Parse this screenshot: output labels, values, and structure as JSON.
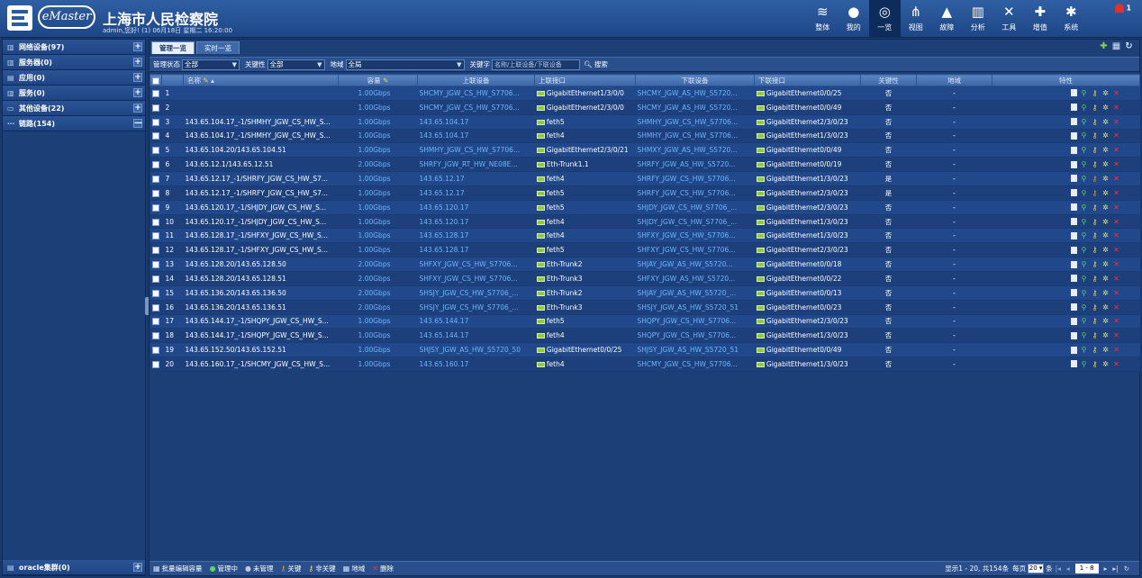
{
  "header": {
    "brand": "eMaster",
    "org_title": "上海市人民检察院",
    "user_info": "admin,您好! (1) 06月18日 星期二 16:20:00",
    "alarm_count": "1",
    "nav": [
      {
        "label": "整体",
        "icon": "layers-icon",
        "glyph": "≋",
        "active": false
      },
      {
        "label": "我的",
        "icon": "user-icon",
        "glyph": "●",
        "active": false
      },
      {
        "label": "一览",
        "icon": "globe-icon",
        "glyph": "◎",
        "active": true
      },
      {
        "label": "视图",
        "icon": "topology-icon",
        "glyph": "⋔",
        "active": false
      },
      {
        "label": "故障",
        "icon": "warning-icon",
        "glyph": "▲",
        "active": false
      },
      {
        "label": "分析",
        "icon": "chart-icon",
        "glyph": "▥",
        "active": false
      },
      {
        "label": "工具",
        "icon": "tools-icon",
        "glyph": "✕",
        "active": false
      },
      {
        "label": "增值",
        "icon": "plus-icon",
        "glyph": "✚",
        "active": false
      },
      {
        "label": "系统",
        "icon": "gear-icon",
        "glyph": "✱",
        "active": false
      }
    ]
  },
  "sidebar": {
    "items": [
      {
        "label": "网络设备(97)",
        "btn": "+"
      },
      {
        "label": "服务器(0)",
        "btn": "+"
      },
      {
        "label": "应用(0)",
        "btn": "+"
      },
      {
        "label": "服务(0)",
        "btn": "+"
      },
      {
        "label": "其他设备(22)",
        "btn": "+"
      },
      {
        "label": "链路(154)",
        "btn": "—"
      }
    ],
    "bottom": {
      "label": "oracle集群(0)",
      "btn": "+"
    }
  },
  "tabs": [
    {
      "label": "管理一览",
      "active": true
    },
    {
      "label": "实时一览",
      "active": false
    }
  ],
  "filters": {
    "mgmt_label": "管理状态",
    "mgmt_value": "全部",
    "key_label": "关键性",
    "key_value": "全部",
    "region_label": "地域",
    "region_value": "全局",
    "keyword_label": "关键字",
    "keyword_placeholder": "名称/上联设备/下联设备",
    "search_label": "搜索"
  },
  "columns": {
    "name": "名称",
    "capacity": "容量",
    "up_device": "上联设备",
    "up_port": "上联接口",
    "down_device": "下联设备",
    "down_port": "下联接口",
    "key": "关键性",
    "region": "地域",
    "props": "特性"
  },
  "rows": [
    {
      "n": "1",
      "name": "",
      "cap": "1.00Gbps",
      "up": "SHCMY_JGW_CS_HW_S7706...",
      "upp": "GigabitEthernet1/3/0/0",
      "down": "SHCMY_JGW_AS_HW_S5720...",
      "downp": "GigabitEthernet0/0/25",
      "key": "否",
      "region": "-"
    },
    {
      "n": "2",
      "name": "",
      "cap": "1.00Gbps",
      "up": "SHCMY_JGW_CS_HW_S7706...",
      "upp": "GigabitEthernet2/3/0/0",
      "down": "SHCMY_JGW_AS_HW_S5720...",
      "downp": "GigabitEthernet0/0/49",
      "key": "否",
      "region": "-"
    },
    {
      "n": "3",
      "name": "143.65.104.17_-1/SHMHY_JGW_CS_HW_S...",
      "cap": "1.00Gbps",
      "up": "143.65.104.17",
      "upp": "feth5",
      "down": "SHMHY_JGW_CS_HW_S7706...",
      "downp": "GigabitEthernet2/3/0/23",
      "key": "否",
      "region": "-"
    },
    {
      "n": "4",
      "name": "143.65.104.17_-1/SHMHY_JGW_CS_HW_S...",
      "cap": "1.00Gbps",
      "up": "143.65.104.17",
      "upp": "feth4",
      "down": "SHMHY_JGW_CS_HW_S7706...",
      "downp": "GigabitEthernet1/3/0/23",
      "key": "否",
      "region": "-"
    },
    {
      "n": "5",
      "name": "143.65.104.20/143.65.104.51",
      "cap": "1.00Gbps",
      "up": "SHMHY_JGW_CS_HW_S7706...",
      "upp": "GigabitEthernet2/3/0/21",
      "down": "SHMXY_JGW_AS_HW_S5720...",
      "downp": "GigabitEthernet0/0/49",
      "key": "否",
      "region": "-"
    },
    {
      "n": "6",
      "name": "143.65.12.1/143.65.12.51",
      "cap": "2.00Gbps",
      "up": "SHRFY_JGW_RT_HW_NE08E...",
      "upp": "Eth-Trunk1.1",
      "down": "SHRFY_JGW_AS_HW_S5720...",
      "downp": "GigabitEthernet0/0/19",
      "key": "否",
      "region": "-"
    },
    {
      "n": "7",
      "name": "143.65.12.17_-1/SHRFY_JGW_CS_HW_S7...",
      "cap": "1.00Gbps",
      "up": "143.65.12.17",
      "upp": "feth4",
      "down": "SHRFY_JGW_CS_HW_S7706...",
      "downp": "GigabitEthernet1/3/0/23",
      "key": "是",
      "region": "-"
    },
    {
      "n": "8",
      "name": "143.65.12.17_-1/SHRFY_JGW_CS_HW_S7...",
      "cap": "1.00Gbps",
      "up": "143.65.12.17",
      "upp": "feth5",
      "down": "SHRFY_JGW_CS_HW_S7706...",
      "downp": "GigabitEthernet2/3/0/23",
      "key": "是",
      "region": "-"
    },
    {
      "n": "9",
      "name": "143.65.120.17_-1/SHJDY_JGW_CS_HW_S...",
      "cap": "1.00Gbps",
      "up": "143.65.120.17",
      "upp": "feth5",
      "down": "SHJDY_JGW_CS_HW_S7706_...",
      "downp": "GigabitEthernet2/3/0/23",
      "key": "否",
      "region": "-"
    },
    {
      "n": "10",
      "name": "143.65.120.17_-1/SHJDY_JGW_CS_HW_S...",
      "cap": "1.00Gbps",
      "up": "143.65.120.17",
      "upp": "feth4",
      "down": "SHJDY_JGW_CS_HW_S7706_...",
      "downp": "GigabitEthernet1/3/0/23",
      "key": "否",
      "region": "-"
    },
    {
      "n": "11",
      "name": "143.65.128.17_-1/SHFXY_JGW_CS_HW_S...",
      "cap": "1.00Gbps",
      "up": "143.65.128.17",
      "upp": "feth4",
      "down": "SHFXY_JGW_CS_HW_S7706...",
      "downp": "GigabitEthernet1/3/0/23",
      "key": "否",
      "region": "-"
    },
    {
      "n": "12",
      "name": "143.65.128.17_-1/SHFXY_JGW_CS_HW_S...",
      "cap": "1.00Gbps",
      "up": "143.65.128.17",
      "upp": "feth5",
      "down": "SHFXY_JGW_CS_HW_S7706...",
      "downp": "GigabitEthernet2/3/0/23",
      "key": "否",
      "region": "-"
    },
    {
      "n": "13",
      "name": "143.65.128.20/143.65.128.50",
      "cap": "2.00Gbps",
      "up": "SHFXY_JGW_CS_HW_S7706...",
      "upp": "Eth-Trunk2",
      "down": "SHJAY_JGW_AS_HW_S5720...",
      "downp": "GigabitEthernet0/0/18",
      "key": "否",
      "region": "-"
    },
    {
      "n": "14",
      "name": "143.65.128.20/143.65.128.51",
      "cap": "2.00Gbps",
      "up": "SHFXY_JGW_CS_HW_S7706...",
      "upp": "Eth-Trunk3",
      "down": "SHFXY_JGW_AS_HW_S5720...",
      "downp": "GigabitEthernet0/0/22",
      "key": "否",
      "region": "-"
    },
    {
      "n": "15",
      "name": "143.65.136.20/143.65.136.50",
      "cap": "2.00Gbps",
      "up": "SHSJY_JGW_CS_HW_S7706_...",
      "upp": "Eth-Trunk2",
      "down": "SHJAY_JGW_AS_HW_S5720_...",
      "downp": "GigabitEthernet0/0/13",
      "key": "否",
      "region": "-"
    },
    {
      "n": "16",
      "name": "143.65.136.20/143.65.136.51",
      "cap": "2.00Gbps",
      "up": "SHSJY_JGW_CS_HW_S7706_...",
      "upp": "Eth-Trunk3",
      "down": "SHSJY_JGW_AS_HW_S5720_51",
      "downp": "GigabitEthernet0/0/23",
      "key": "否",
      "region": "-"
    },
    {
      "n": "17",
      "name": "143.65.144.17_-1/SHQPY_JGW_CS_HW_S...",
      "cap": "1.00Gbps",
      "up": "143.65.144.17",
      "upp": "feth5",
      "down": "SHQPY_JGW_CS_HW_S7706...",
      "downp": "GigabitEthernet2/3/0/23",
      "key": "否",
      "region": "-"
    },
    {
      "n": "18",
      "name": "143.65.144.17_-1/SHQPY_JGW_CS_HW_S...",
      "cap": "1.00Gbps",
      "up": "143.65.144.17",
      "upp": "feth4",
      "down": "SHQPY_JGW_CS_HW_S7706...",
      "downp": "GigabitEthernet1/3/0/23",
      "key": "否",
      "region": "-"
    },
    {
      "n": "19",
      "name": "143.65.152.50/143.65.152.51",
      "cap": "1.00Gbps",
      "up": "SHJSY_JGW_AS_HW_S5720_50",
      "upp": "GigabitEthernet0/0/25",
      "down": "SHJSY_JGW_AS_HW_S5720_51",
      "downp": "GigabitEthernet0/0/49",
      "key": "否",
      "region": "-"
    },
    {
      "n": "20",
      "name": "143.65.160.17_-1/SHCMY_JGW_CS_HW_S...",
      "cap": "1.00Gbps",
      "up": "143.65.160.17",
      "upp": "feth4",
      "down": "SHCMY_JGW_CS_HW_S7706...",
      "downp": "GigabitEthernet1/3/0/23",
      "key": "否",
      "region": "-"
    }
  ],
  "footer": {
    "batch_edit": "批量编辑容量",
    "managed": "管理中",
    "unmanaged": "未管理",
    "key": "关键",
    "nonkey": "非关键",
    "region": "地域",
    "delete": "删除",
    "summary": "显示1 - 20, 共154条",
    "per_page_label": "每页",
    "per_page_value": "20",
    "per_page_unit": "条",
    "page_box": "1 - 8"
  },
  "colors": {
    "accent": "#6fb6ff",
    "header_bg": "#1d4686",
    "row_odd": "#20488a",
    "row_even": "#1d3f7b",
    "delete_red": "#ff3030"
  }
}
